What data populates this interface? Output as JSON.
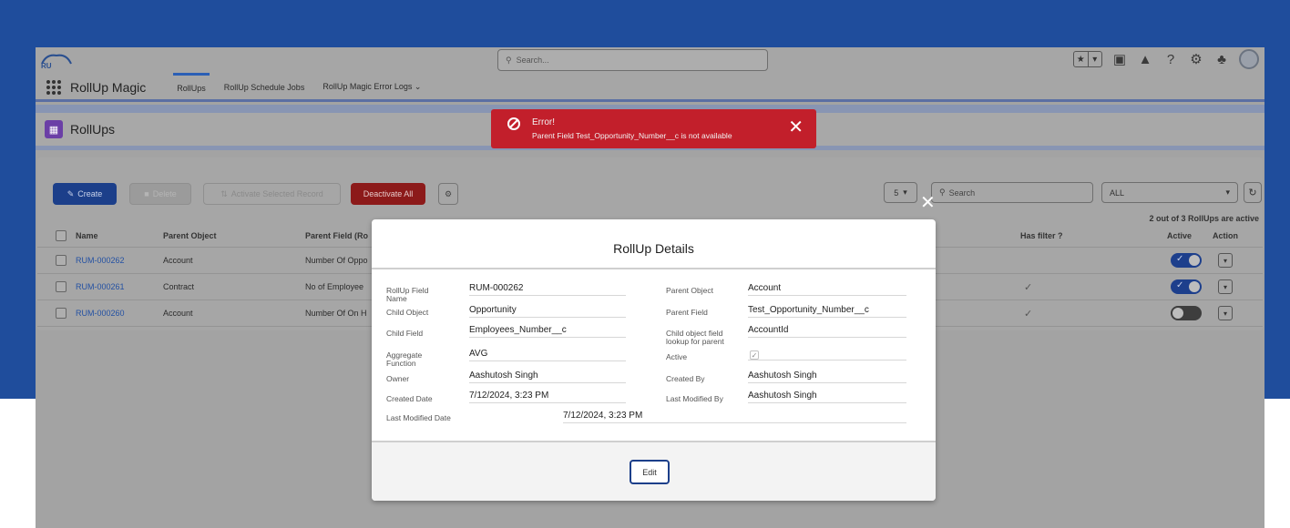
{
  "header": {
    "search_placeholder": "Search...",
    "icons": [
      "favorites-star-icon",
      "favorites-dropdown-icon",
      "add-icon",
      "trailhead-icon",
      "help-icon",
      "gear-icon",
      "bell-icon",
      "avatar"
    ]
  },
  "nav": {
    "app_name": "RollUp Magic",
    "tabs": [
      {
        "label": "RollUps",
        "active": true
      },
      {
        "label": "RollUp Schedule Jobs",
        "active": false
      },
      {
        "label": "RollUp Magic Error Logs",
        "active": false
      }
    ]
  },
  "page": {
    "title": "RollUps"
  },
  "toolbar": {
    "create": "Create",
    "delete": "Delete",
    "activate_selected": "Activate Selected Record",
    "deactivate_all": "Deactivate All",
    "page_size": "5",
    "search_placeholder": "Search",
    "filter_value": "ALL",
    "count_note": "2 out of 3 RollUps are active"
  },
  "table": {
    "headers": {
      "name": "Name",
      "parent_object": "Parent Object",
      "parent_field": "Parent Field (Ro",
      "has_filter": "Has filter ?",
      "active": "Active",
      "action": "Action"
    },
    "rows": [
      {
        "name": "RUM-000262",
        "parent_object": "Account",
        "parent_field": "Number Of Oppo",
        "has_filter": false,
        "active": true
      },
      {
        "name": "RUM-000261",
        "parent_object": "Contract",
        "parent_field": "No of Employee",
        "has_filter": true,
        "active": true
      },
      {
        "name": "RUM-000260",
        "parent_object": "Account",
        "parent_field": "Number Of On H",
        "has_filter": true,
        "active": false
      }
    ]
  },
  "toast": {
    "title": "Error!",
    "message": "Parent Field Test_Opportunity_Number__c is not available"
  },
  "modal": {
    "title": "RollUp Details",
    "fields": {
      "rollup_field_name_label": "RollUp Field Name",
      "rollup_field_name": "RUM-000262",
      "parent_object_label": "Parent Object",
      "parent_object": "Account",
      "child_object_label": "Child Object",
      "child_object": "Opportunity",
      "parent_field_label": "Parent Field",
      "parent_field": "Test_Opportunity_Number__c",
      "child_field_label": "Child Field",
      "child_field": "Employees_Number__c",
      "lookup_label": "Child object field lookup for parent",
      "lookup": "AccountId",
      "aggregate_label": "Aggregate Function",
      "aggregate": "AVG",
      "active_label": "Active",
      "owner_label": "Owner",
      "owner": "Aashutosh Singh",
      "created_by_label": "Created By",
      "created_by": "Aashutosh Singh",
      "created_date_label": "Created Date",
      "created_date": "7/12/2024, 3:23 PM",
      "modified_by_label": "Last Modified By",
      "modified_by": "Aashutosh Singh",
      "modified_date_label": "Last Modified Date",
      "modified_date": "7/12/2024, 3:23 PM"
    },
    "active_checked": true,
    "edit": "Edit"
  },
  "colors": {
    "background_blue": "#1f4d9c",
    "brand_blue": "#1c3f8a",
    "error_red": "#c21f2b",
    "link_blue": "#2451a3"
  }
}
